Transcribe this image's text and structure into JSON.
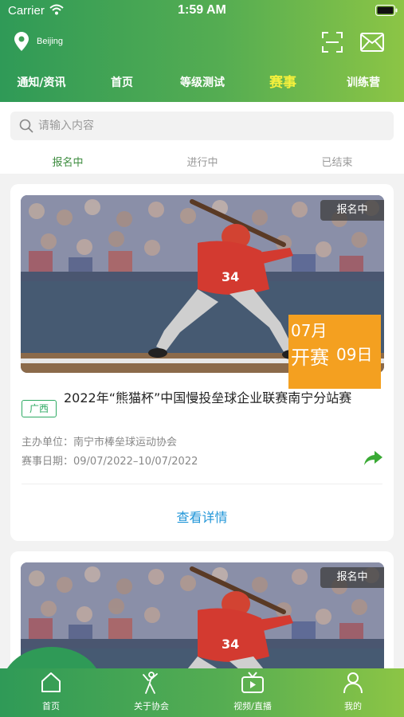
{
  "status_bar": {
    "carrier": "Carrier",
    "time": "1:59 AM"
  },
  "header": {
    "location": "Beijing",
    "nav_tabs": [
      {
        "label": "通知/资讯",
        "active": false
      },
      {
        "label": "首页",
        "active": false
      },
      {
        "label": "等级测试",
        "active": false
      },
      {
        "label": "赛事",
        "active": true
      },
      {
        "label": "训练营",
        "active": false
      }
    ]
  },
  "search": {
    "placeholder": "请输入内容",
    "value": ""
  },
  "status_tabs": [
    {
      "label": "报名中",
      "active": true
    },
    {
      "label": "进行中",
      "active": false
    },
    {
      "label": "已结束",
      "active": false
    }
  ],
  "cards": [
    {
      "status": "报名中",
      "date_badge": {
        "month": "07月",
        "open": "开赛",
        "day": "09日"
      },
      "region": "广西",
      "title": "2022年“熊猫杯”中国慢投垒球企业联赛南宁分站赛",
      "organizer": "主办单位：南宁市棒垒球运动协会",
      "dates": "赛事日期：09/07/2022–10/07/2022",
      "detail_label": "查看详情"
    },
    {
      "status": "报名中"
    }
  ],
  "bottom_nav": [
    {
      "label": "首页",
      "icon": "home-icon"
    },
    {
      "label": "关于协会",
      "icon": "batter-icon"
    },
    {
      "label": "视频/直播",
      "icon": "tv-icon"
    },
    {
      "label": "我的",
      "icon": "user-icon"
    }
  ],
  "colors": {
    "brand_green": "#2f9a57",
    "accent_yellow": "#f5f03c",
    "badge_orange": "#f4a020",
    "link_blue": "#2196d8"
  }
}
